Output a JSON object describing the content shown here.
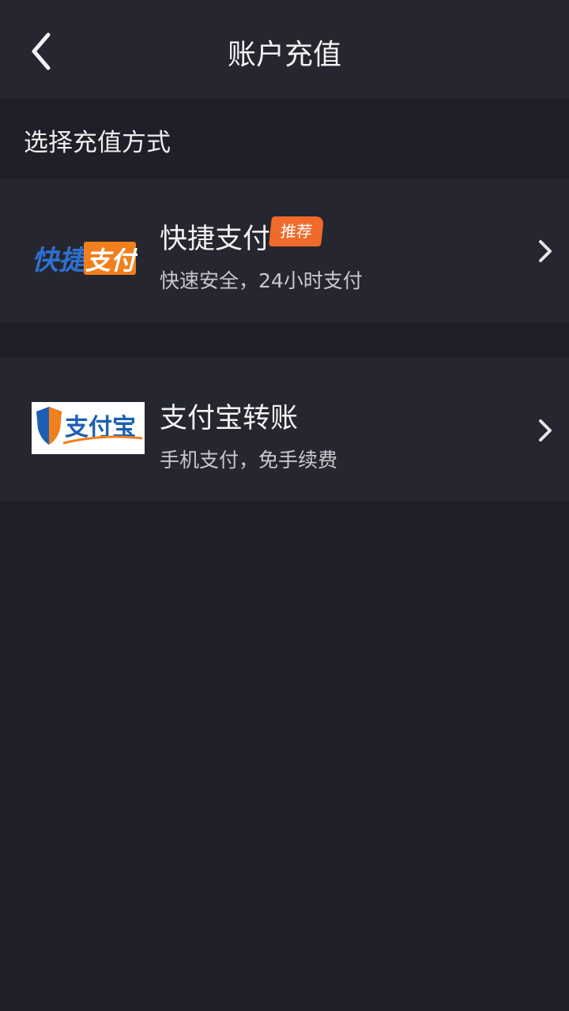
{
  "header": {
    "title": "账户充值",
    "back_icon": "chevron-left-icon"
  },
  "section": {
    "label": "选择充值方式"
  },
  "methods": [
    {
      "title": "快捷支付",
      "badge": "推荐",
      "description": "快速安全，24小时支付",
      "logo_text_left": "快捷",
      "logo_text_right": "支付",
      "logo_colors": {
        "blue": "#2f6fcf",
        "orange": "#f07f1c"
      }
    },
    {
      "title": "支付宝转账",
      "description": "手机支付，免手续费",
      "logo_text": "支付宝",
      "logo_colors": {
        "blue": "#1c5fb5",
        "orange": "#f07f1c"
      }
    }
  ],
  "colors": {
    "background": "#1e1f28",
    "panel": "#25262f",
    "badge": "#f06a2a"
  }
}
